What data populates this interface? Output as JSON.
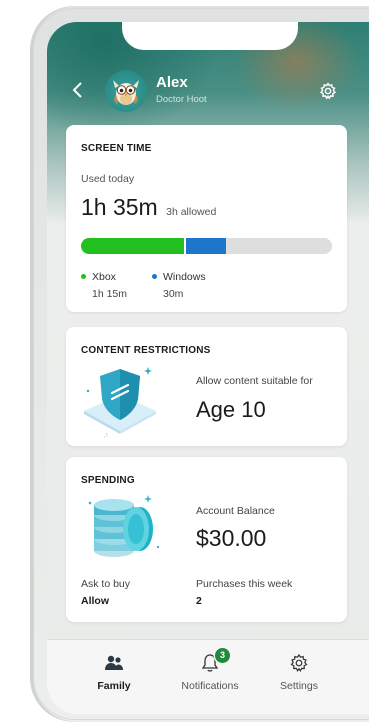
{
  "profile": {
    "name": "Alex",
    "gamertag": "Doctor Hoot"
  },
  "screen_time": {
    "title": "SCREEN TIME",
    "used_label": "Used today",
    "used_value": "1h 35m",
    "allowed": "3h allowed",
    "bar_fractions": {
      "xbox": 0.41,
      "windows": 0.16
    },
    "devices": [
      {
        "name": "Xbox",
        "time": "1h 15m",
        "color": "#21c01f"
      },
      {
        "name": "Windows",
        "time": "30m",
        "color": "#1d76c9"
      }
    ]
  },
  "content_restrictions": {
    "title": "CONTENT RESTRICTIONS",
    "allow_label": "Allow content suitable for",
    "age": "Age 10"
  },
  "spending": {
    "title": "SPENDING",
    "balance_label": "Account Balance",
    "balance": "$30.00",
    "ask_label": "Ask to buy",
    "ask_value": "Allow",
    "purchases_label": "Purchases this week",
    "purchases_value": "2"
  },
  "tabs": [
    {
      "label": "Family",
      "icon": "family-icon",
      "active": true
    },
    {
      "label": "Notifications",
      "icon": "bell-icon",
      "badge": "3"
    },
    {
      "label": "Settings",
      "icon": "gear-icon"
    }
  ],
  "colors": {
    "accent_green": "#21c01f",
    "accent_blue": "#1d76c9",
    "badge_green": "#1f8a3a",
    "header_teal": "#2e7f75"
  }
}
